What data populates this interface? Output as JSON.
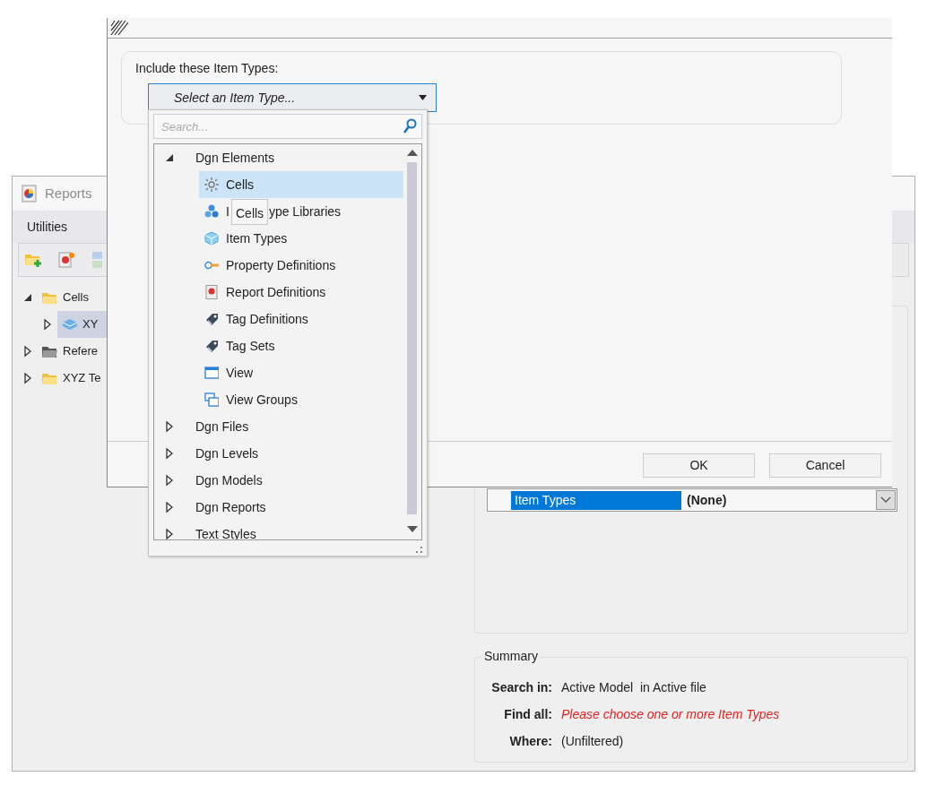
{
  "reports_window": {
    "title": "Reports",
    "menu": [
      "Utilities"
    ],
    "tree": [
      {
        "label": "Cells",
        "expanded": true,
        "selected": false,
        "children": [
          {
            "label": "XY",
            "expanded": false,
            "selected": true
          }
        ]
      },
      {
        "label": "Refere",
        "expanded": false,
        "selected": false
      },
      {
        "label": "XYZ Te",
        "expanded": false,
        "selected": false
      }
    ],
    "property_row": {
      "label": "Item Types",
      "value": "(None)",
      "selected": true
    },
    "summary": {
      "title": "Summary",
      "rows": [
        {
          "label": "Search in:",
          "value": "Active Model  in Active file",
          "kind": "normal"
        },
        {
          "label": "Find all:",
          "value": "Please choose one or more Item Types",
          "kind": "warning"
        },
        {
          "label": "Where:",
          "value": "(Unfiltered)",
          "kind": "normal"
        }
      ]
    }
  },
  "dialog": {
    "group_label": "Include these Item Types:",
    "combo": {
      "placeholder": "Select an Item Type..."
    },
    "popup": {
      "search": {
        "placeholder": "Search..."
      },
      "tree": [
        {
          "label": "Dgn Elements",
          "expanded": true,
          "children": [
            {
              "label_parts": [
                "Cells"
              ],
              "selected": true
            },
            {
              "label_parts": [
                "I",
                "ype Libraries"
              ],
              "selected": false
            },
            {
              "label_parts": [
                "Item Types"
              ],
              "selected": false
            },
            {
              "label_parts": [
                "Property Definitions"
              ],
              "selected": false
            },
            {
              "label_parts": [
                "Report Definitions"
              ],
              "selected": false
            },
            {
              "label_parts": [
                "Tag Definitions"
              ],
              "selected": false
            },
            {
              "label_parts": [
                "Tag Sets"
              ],
              "selected": false
            },
            {
              "label_parts": [
                "View"
              ],
              "selected": false
            },
            {
              "label_parts": [
                "View Groups"
              ],
              "selected": false
            }
          ]
        },
        {
          "label": "Dgn Files",
          "expanded": false
        },
        {
          "label": "Dgn Levels",
          "expanded": false
        },
        {
          "label": "Dgn Models",
          "expanded": false
        },
        {
          "label": "Dgn Reports",
          "expanded": false
        },
        {
          "label": "Text Styles",
          "expanded": false
        }
      ],
      "tooltip": "Cells"
    },
    "buttons": [
      "OK",
      "Cancel"
    ]
  }
}
